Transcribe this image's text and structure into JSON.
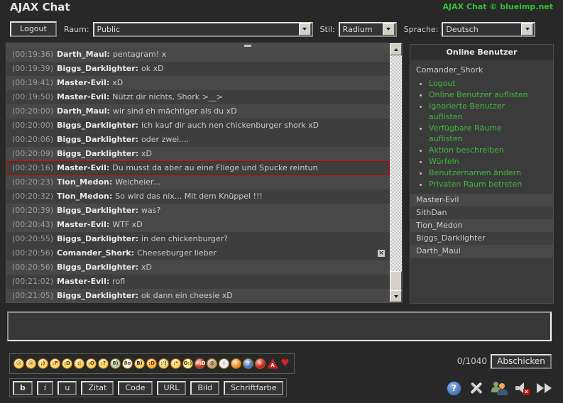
{
  "header": {
    "title": "AJAX Chat",
    "brand_link": "AJAX Chat © blueimp.net"
  },
  "toolbar": {
    "logout_label": "Logout",
    "room_label": "Raum:",
    "room_value": "Public",
    "style_label": "Stil:",
    "style_value": "Radium",
    "language_label": "Sprache:",
    "language_value": "Deutsch"
  },
  "chat": {
    "messages": [
      {
        "time": "(00:19:36)",
        "user": "Darth_Maul",
        "text": "pentagram! x",
        "shade": "L",
        "highlight": false,
        "deletable": false
      },
      {
        "time": "(00:19:39)",
        "user": "Biggs_Darklighter",
        "text": "ok xD",
        "shade": "D",
        "highlight": false,
        "deletable": false
      },
      {
        "time": "(00:19:41)",
        "user": "Master-Evil",
        "text": "xD",
        "shade": "L",
        "highlight": false,
        "deletable": false
      },
      {
        "time": "(00:19:50)",
        "user": "Master-Evil",
        "text": "Nützt dir nichts, Shork >__>",
        "shade": "D",
        "highlight": false,
        "deletable": false
      },
      {
        "time": "(00:20:00)",
        "user": "Darth_Maul",
        "text": "wir sind eh mächtiger als du xD",
        "shade": "L",
        "highlight": false,
        "deletable": false
      },
      {
        "time": "(00:20:00)",
        "user": "Biggs_Darklighter",
        "text": "ich kauf dir auch nen chickenburger shork xD",
        "shade": "D",
        "highlight": false,
        "deletable": false
      },
      {
        "time": "(00:20:06)",
        "user": "Biggs_Darklighter",
        "text": "oder zwei....",
        "shade": "D",
        "highlight": false,
        "deletable": false
      },
      {
        "time": "(00:20:09)",
        "user": "Biggs_Darklighter",
        "text": "xD",
        "shade": "L",
        "highlight": false,
        "deletable": false
      },
      {
        "time": "(00:20:16)",
        "user": "Master-Evil",
        "text": "Du musst da aber au eine Fliege und Spucke reintun",
        "shade": "D",
        "highlight": true,
        "deletable": false
      },
      {
        "time": "(00:20:23)",
        "user": "Tion_Medon",
        "text": "Weicheier...",
        "shade": "L",
        "highlight": false,
        "deletable": false
      },
      {
        "time": "(00:20:32)",
        "user": "Tion_Medon",
        "text": "So wird das nix... Mit dem Knüppel !!!",
        "shade": "D",
        "highlight": false,
        "deletable": false
      },
      {
        "time": "(00:20:39)",
        "user": "Biggs_Darklighter",
        "text": "was?",
        "shade": "L",
        "highlight": false,
        "deletable": false
      },
      {
        "time": "(00:20:43)",
        "user": "Master-Evil",
        "text": "WTF xD",
        "shade": "L",
        "highlight": false,
        "deletable": false
      },
      {
        "time": "(00:20:55)",
        "user": "Biggs_Darklighter",
        "text": "in den chickenburger?",
        "shade": "D",
        "highlight": false,
        "deletable": false
      },
      {
        "time": "(00:20:56)",
        "user": "Comander_Shork",
        "text": "Cheeseburger lieber",
        "shade": "D",
        "highlight": false,
        "deletable": true
      },
      {
        "time": "(00:20:56)",
        "user": "Biggs_Darklighter",
        "text": "xD",
        "shade": "L",
        "highlight": false,
        "deletable": false
      },
      {
        "time": "(00:21:02)",
        "user": "Master-Evil",
        "text": "rofl",
        "shade": "D",
        "highlight": false,
        "deletable": false
      },
      {
        "time": "(00:21:05)",
        "user": "Biggs_Darklighter",
        "text": "ok dann ein cheesie xD",
        "shade": "L",
        "highlight": false,
        "deletable": false
      }
    ]
  },
  "sidebar": {
    "title": "Online Benutzer",
    "current_user": "Comander_Shork",
    "actions": [
      "Logout",
      "Online Benutzer auflisten",
      "Ignorierte Benutzer\nauflisten",
      "Verfügbare Räume\nauflisten",
      "Aktion beschreiben",
      "Würfeln",
      "Benutzernamen ändern",
      "Privaten Raum betreten"
    ],
    "users": [
      {
        "name": "Master-Evil",
        "shade": "L"
      },
      {
        "name": "SithDan",
        "shade": "D"
      },
      {
        "name": "Tion_Medon",
        "shade": "L"
      },
      {
        "name": "Biggs_Darklighter",
        "shade": "D"
      },
      {
        "name": "Darth_Maul",
        "shade": "L"
      }
    ]
  },
  "composer": {
    "counter": "0/1040",
    "send_label": "Abschicken"
  },
  "emoticons": [
    {
      "name": "smile",
      "glyph": "☺",
      "bg": "#fdd35c",
      "fg": "#5a3a00",
      "shape": "circle"
    },
    {
      "name": "sad",
      "glyph": "☹",
      "bg": "#fdd35c",
      "fg": "#5a3a00",
      "shape": "circle"
    },
    {
      "name": "wink",
      "glyph": ";)",
      "bg": "#fdd35c",
      "fg": "#5a3a00",
      "shape": "circle"
    },
    {
      "name": "tongue",
      "glyph": ":P",
      "bg": "#fdd35c",
      "fg": "#aa2020",
      "shape": "circle"
    },
    {
      "name": "grin",
      "glyph": ":D",
      "bg": "#fdd35c",
      "fg": "#5a3a00",
      "shape": "circle"
    },
    {
      "name": "neutral",
      "glyph": ":|",
      "bg": "#fdd35c",
      "fg": "#5a3a00",
      "shape": "circle"
    },
    {
      "name": "surprised",
      "glyph": ":O",
      "bg": "#fdd35c",
      "fg": "#5a3a00",
      "shape": "circle"
    },
    {
      "name": "confused",
      "glyph": ":?",
      "bg": "#fdd35c",
      "fg": "#5a3a00",
      "shape": "circle"
    },
    {
      "name": "glasses",
      "glyph": "8)",
      "bg": "#b9c9a9",
      "fg": "#303a28",
      "shape": "circle"
    },
    {
      "name": "eek",
      "glyph": "8o",
      "bg": "#f2f0cf",
      "fg": "#404040",
      "shape": "circle"
    },
    {
      "name": "cool",
      "glyph": "B)",
      "bg": "#fdd35c",
      "fg": "#202020",
      "shape": "circle"
    },
    {
      "name": "laughing",
      "glyph": ":D",
      "bg": "#f8b224",
      "fg": "#a01010",
      "shape": "circle"
    },
    {
      "name": "crying",
      "glyph": ":'(",
      "bg": "#f0d060",
      "fg": "#30507a",
      "shape": "circle"
    },
    {
      "name": "kiss",
      "glyph": ":*",
      "bg": "#fdd35c",
      "fg": "#b02020",
      "shape": "circle"
    },
    {
      "name": "angel",
      "glyph": "O:)",
      "bg": "#fde98c",
      "fg": "#5a3a00",
      "shape": "circle"
    },
    {
      "name": "devil",
      "glyph": ">:D",
      "bg": "#d03020",
      "fg": "#ffffff",
      "shape": "circle"
    },
    {
      "name": "monkey",
      "glyph": "@",
      "bg": "#c8a070",
      "fg": "#50351a",
      "shape": "circle"
    },
    {
      "name": "idea",
      "glyph": "i",
      "bg": "#e9e9f5",
      "fg": "#8a8a30",
      "shape": "circle"
    },
    {
      "name": "exclaim",
      "glyph": "!",
      "bg": "#f09020",
      "fg": "#ffffff",
      "shape": "circle"
    },
    {
      "name": "question",
      "glyph": "?",
      "bg": "#4878c0",
      "fg": "#ffffff",
      "shape": "circle"
    },
    {
      "name": "stop",
      "glyph": "–",
      "bg": "#d02020",
      "fg": "#ffffff",
      "shape": "circle"
    },
    {
      "name": "warning",
      "glyph": "A",
      "bg": "#d02020",
      "fg": "#ffffff",
      "shape": "triangle"
    },
    {
      "name": "heart",
      "glyph": "♥",
      "bg": "",
      "fg": "#d42020",
      "shape": "plain"
    }
  ],
  "format_buttons": [
    {
      "name": "bold",
      "label": "b"
    },
    {
      "name": "italic",
      "label": "i"
    },
    {
      "name": "underline",
      "label": "u"
    },
    {
      "name": "quote",
      "label": "Zitat"
    },
    {
      "name": "code",
      "label": "Code"
    },
    {
      "name": "url",
      "label": "URL"
    },
    {
      "name": "image",
      "label": "Bild"
    },
    {
      "name": "font-color",
      "label": "Schriftfarbe"
    }
  ],
  "icons": {
    "help_glyph": "?",
    "mute_glyph": "x"
  },
  "colors": {
    "accent_green": "#3eb83e",
    "highlight_red": "#c00000",
    "row_light": "#484848",
    "row_dark": "#3e3e3e"
  }
}
